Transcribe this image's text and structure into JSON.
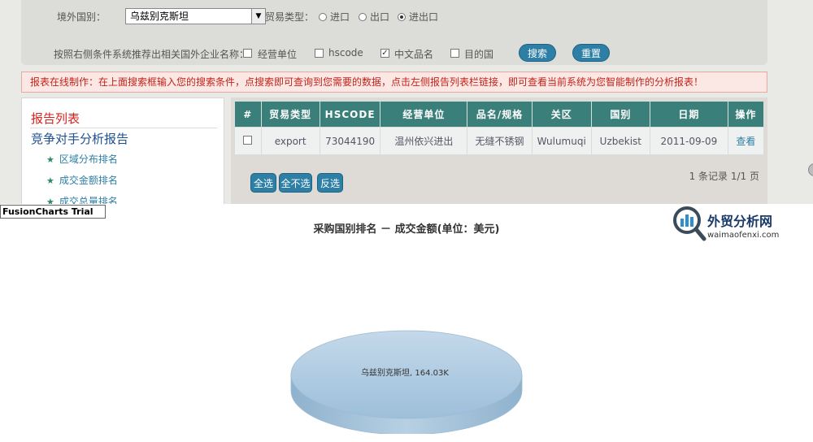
{
  "search": {
    "country_label": "境外国别：",
    "country_value": "乌兹别克斯坦",
    "trade_type_label": "贸易类型：",
    "trade_options": [
      {
        "label": "进口",
        "selected": false
      },
      {
        "label": "出口",
        "selected": false
      },
      {
        "label": "进出口",
        "selected": true
      }
    ],
    "recommend_label": "按照右侧条件系统推荐出相关国外企业名称：",
    "criteria": [
      {
        "label": "经营单位",
        "checked": false
      },
      {
        "label": "hscode",
        "checked": false
      },
      {
        "label": "中文品名",
        "checked": true
      },
      {
        "label": "目的国",
        "checked": false
      }
    ],
    "search_button": "搜索",
    "reset_button": "重置"
  },
  "notice": "报表在线制作：在上面搜索框输入您的搜索条件，点搜索即可查询到您需要的数据，点击左侧报告列表栏链接，即可查看当前系统为您智能制作的分析报表！",
  "sidebar": {
    "title": "报告列表",
    "subtitle": "竞争对手分析报告",
    "items": [
      "区域分布排名",
      "成交金额排名",
      "成交总量排名"
    ]
  },
  "table": {
    "headers": [
      "#",
      "贸易类型",
      "HSCODE",
      "经营单位",
      "品名/规格",
      "关区",
      "国别",
      "日期",
      "操作"
    ],
    "rows": [
      [
        "export",
        "73044190",
        "温州依兴进出",
        "无缝不锈钢",
        "Wulumuqi",
        "Uzbekist",
        "2011-09-09",
        "查看"
      ]
    ],
    "select_all": "全选",
    "select_none": "全不选",
    "invert": "反选",
    "records": "1 条记录 1/1 页"
  },
  "trial_label": "FusionCharts Trial",
  "brand": {
    "name": "外贸分析网",
    "url": "waimaofenxi.com"
  },
  "chart_data": {
    "type": "pie",
    "title": "采购国别排名 － 成交金额(单位：美元)",
    "slices": [
      {
        "label": "乌兹别克斯坦, 164.03K",
        "value": 164030
      }
    ]
  },
  "colors": {
    "accent": "#2d7fa6",
    "header_teal": "#3a7f7a",
    "notice_red": "#c1241b",
    "pie_top": "#a9c8df"
  }
}
